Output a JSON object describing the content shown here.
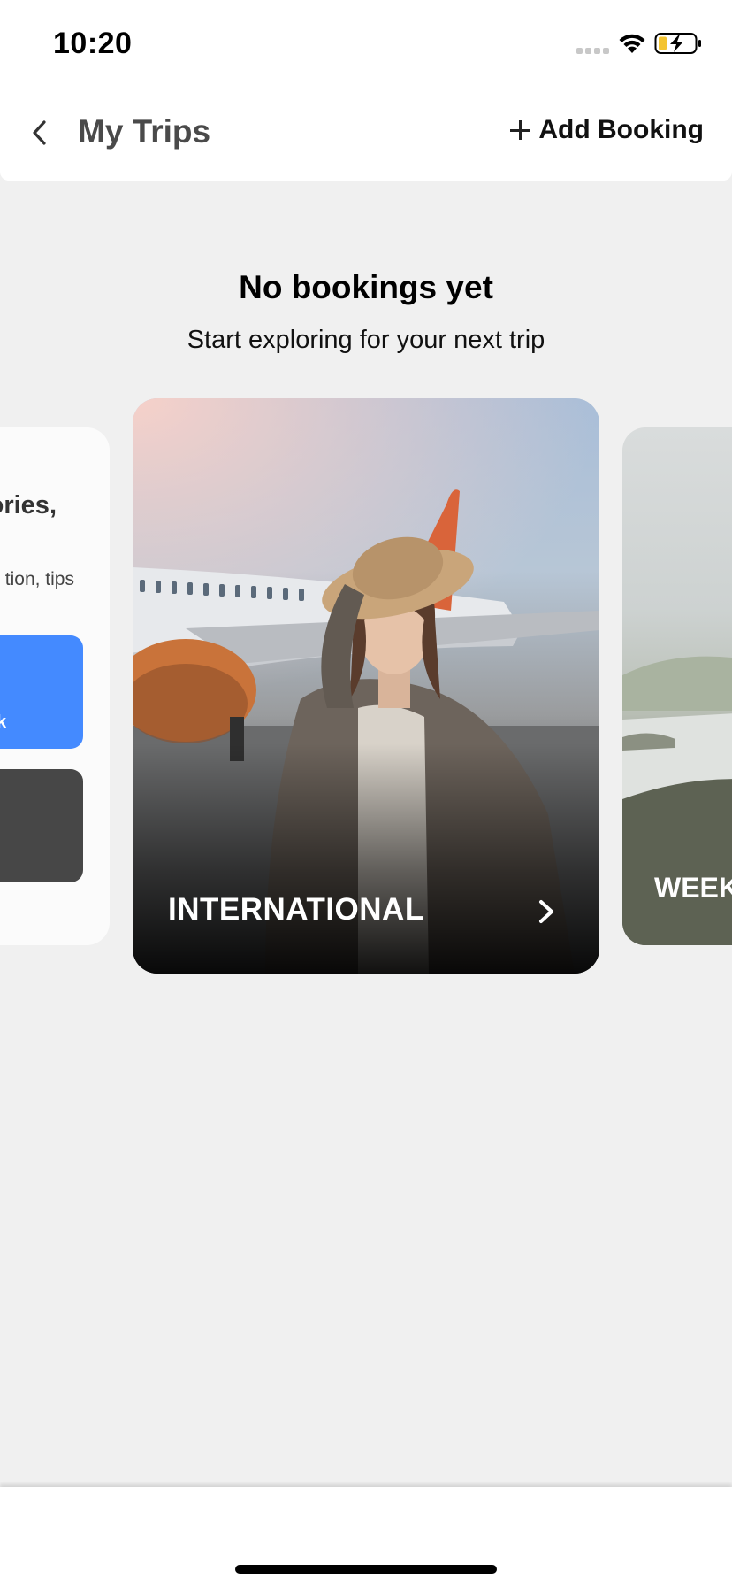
{
  "status_bar": {
    "time": "10:20",
    "icons": [
      "signal-icon",
      "wifi-icon",
      "battery-charging-icon"
    ],
    "battery_color": "#f4c430"
  },
  "header": {
    "back_icon": "chevron-left-icon",
    "title": "My Trips",
    "add_booking_label": "Add Booking",
    "add_icon": "plus-icon"
  },
  "empty_state": {
    "title": "No bookings yet",
    "subtitle": "Start exploring for your next trip"
  },
  "carousel": {
    "left_card": {
      "title_fragment": "ories,",
      "subtitle_fragment": "tion, tips",
      "primary_button_fragment": "k",
      "primary_color": "#448aff",
      "secondary_color": "#474747"
    },
    "main_card": {
      "label": "INTERNATIONAL",
      "icon": "chevron-right-icon"
    },
    "right_card": {
      "label_fragment": "WEEK"
    }
  }
}
